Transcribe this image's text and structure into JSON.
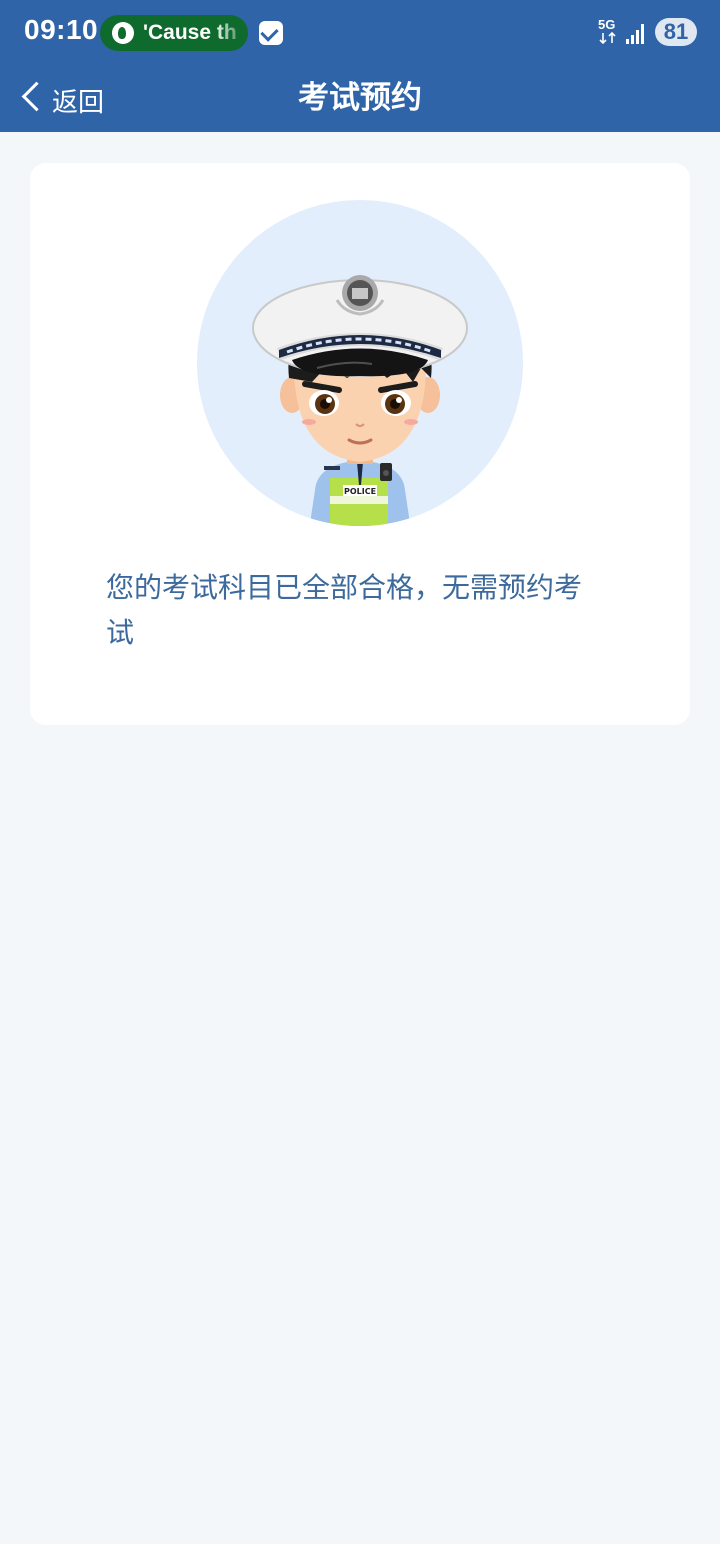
{
  "status_bar": {
    "time": "09:10",
    "music_text": "'Cause th",
    "network": "5G",
    "battery": "81"
  },
  "navbar": {
    "back_label": "返回",
    "title": "考试预约"
  },
  "main": {
    "illustration_badge": "POLICE",
    "message": "您的考试科目已全部合格，无需预约考试"
  },
  "colors": {
    "header_bg": "#2f64a8",
    "page_bg": "#f3f7f9",
    "message_text": "#3d6a9c",
    "avatar_bg": "#e3eefc"
  }
}
